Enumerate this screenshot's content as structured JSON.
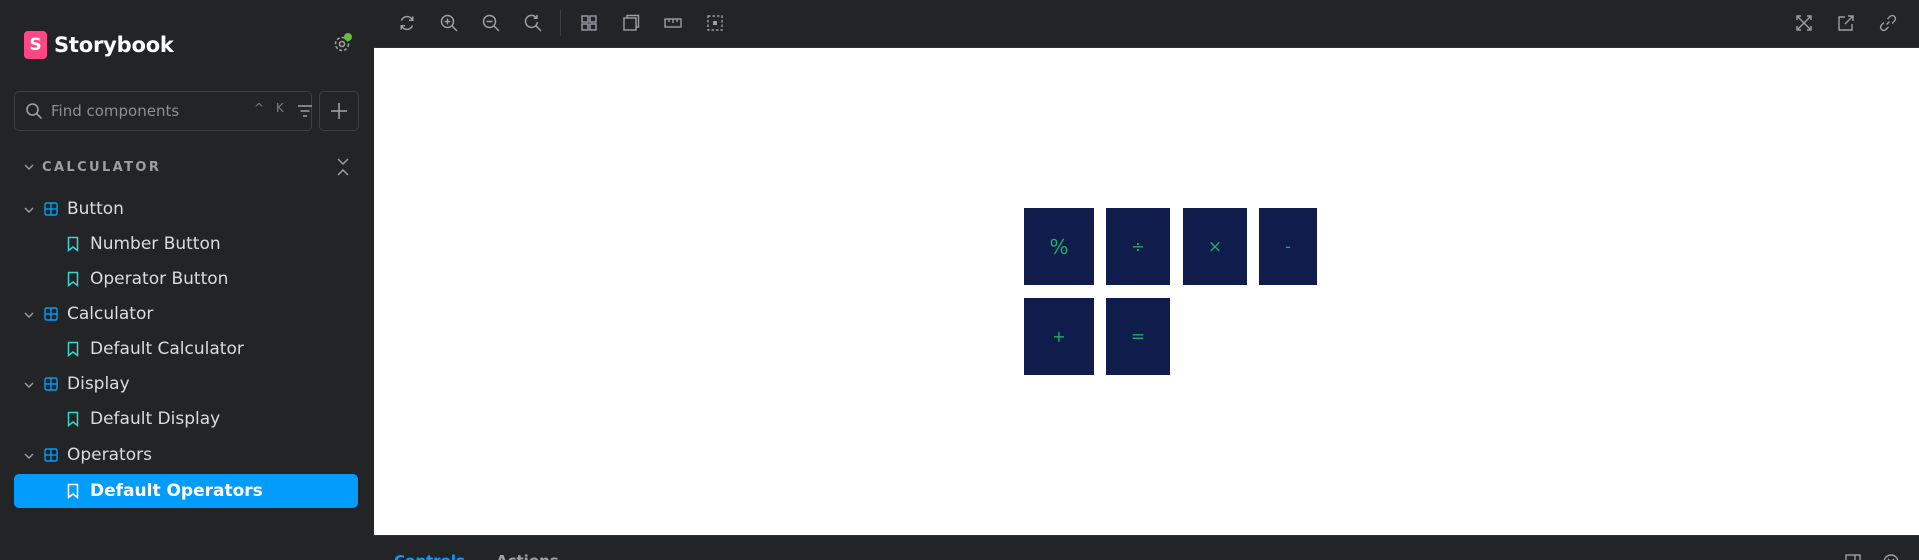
{
  "brand": {
    "logo_letter": "S",
    "name": "Storybook",
    "accent": "#ff4785"
  },
  "search": {
    "placeholder": "Find components",
    "shortcut": "^ K"
  },
  "sidebar": {
    "section": "CALCULATOR",
    "items": [
      {
        "type": "component",
        "label": "Button"
      },
      {
        "type": "story",
        "label": "Number Button"
      },
      {
        "type": "story",
        "label": "Operator Button"
      },
      {
        "type": "component",
        "label": "Calculator"
      },
      {
        "type": "story",
        "label": "Default Calculator"
      },
      {
        "type": "component",
        "label": "Display"
      },
      {
        "type": "story",
        "label": "Default Display"
      },
      {
        "type": "component",
        "label": "Operators"
      },
      {
        "type": "story",
        "label": "Default Operators",
        "selected": true
      }
    ]
  },
  "toolbar": {
    "left": [
      "remount-icon",
      "zoom-in-icon",
      "zoom-out-icon",
      "zoom-reset-icon",
      "grid-icon",
      "background-icon",
      "measure-icon",
      "outline-icon"
    ],
    "right": [
      "fullscreen-icon",
      "open-new-tab-icon",
      "copy-link-icon"
    ]
  },
  "preview": {
    "buttons": [
      "%",
      "÷",
      "×",
      "-",
      "+",
      "="
    ],
    "button_bg": "#101c4c",
    "button_fg": "#17b169"
  },
  "panel": {
    "tabs": [
      "Controls",
      "Actions"
    ],
    "active_tab": "Controls"
  },
  "colors": {
    "selected": "#029cfd",
    "status_dot": "#66bf3c",
    "sidebar_bg": "#222425"
  }
}
